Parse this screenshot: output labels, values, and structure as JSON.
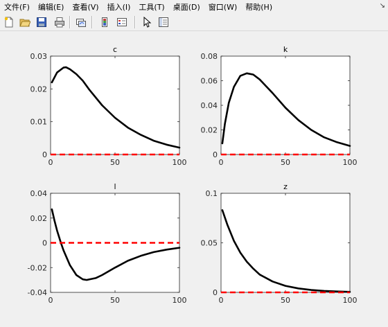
{
  "menu": {
    "items": [
      {
        "label": "文件(F)"
      },
      {
        "label": "编辑(E)"
      },
      {
        "label": "查看(V)"
      },
      {
        "label": "插入(I)"
      },
      {
        "label": "工具(T)"
      },
      {
        "label": "桌面(D)"
      },
      {
        "label": "窗口(W)"
      },
      {
        "label": "帮助(H)"
      }
    ],
    "dock_arrow": "↘"
  },
  "toolbar": {
    "buttons": [
      "new-figure-icon",
      "open-file-icon",
      "save-icon",
      "print-icon",
      "link-plot-icon",
      "insert-colorbar-icon",
      "insert-legend-icon",
      "edit-plot-arrow-icon",
      "property-inspector-icon"
    ]
  },
  "colors": {
    "series": "#000000",
    "zero_line": "#ff0000",
    "axes_bg": "#ffffff",
    "figure_bg": "#f0f0f0"
  },
  "chart_data": [
    {
      "type": "line",
      "title": "c",
      "xlim": [
        0,
        100
      ],
      "ylim": [
        0,
        0.03
      ],
      "xticks": [
        0,
        50,
        100
      ],
      "xtick_labels": [
        "0",
        "50",
        "100"
      ],
      "yticks": [
        0,
        0.01,
        0.02,
        0.03
      ],
      "ytick_labels": [
        "0",
        "0.01",
        "0.02",
        "0.03"
      ],
      "series": [
        {
          "x": [
            1,
            5,
            10,
            12,
            15,
            20,
            25,
            30,
            40,
            50,
            60,
            70,
            80,
            90,
            100
          ],
          "y": [
            0.022,
            0.025,
            0.0265,
            0.0266,
            0.026,
            0.0245,
            0.0225,
            0.0198,
            0.015,
            0.0112,
            0.0082,
            0.006,
            0.0042,
            0.003,
            0.0021
          ],
          "style": "solid"
        },
        {
          "x": [
            0,
            100
          ],
          "y": [
            0,
            0
          ],
          "style": "dashed"
        }
      ]
    },
    {
      "type": "line",
      "title": "k",
      "xlim": [
        0,
        100
      ],
      "ylim": [
        0,
        0.08
      ],
      "xticks": [
        0,
        50,
        100
      ],
      "xtick_labels": [
        "0",
        "50",
        "100"
      ],
      "yticks": [
        0,
        0.02,
        0.04,
        0.06,
        0.08
      ],
      "ytick_labels": [
        "0",
        "0.02",
        "0.04",
        "0.06",
        "0.08"
      ],
      "series": [
        {
          "x": [
            1,
            3,
            6,
            10,
            15,
            20,
            25,
            30,
            40,
            50,
            60,
            70,
            80,
            90,
            100
          ],
          "y": [
            0.009,
            0.025,
            0.042,
            0.055,
            0.064,
            0.066,
            0.065,
            0.061,
            0.05,
            0.038,
            0.028,
            0.02,
            0.014,
            0.01,
            0.007
          ],
          "style": "solid"
        },
        {
          "x": [
            0,
            100
          ],
          "y": [
            0,
            0
          ],
          "style": "dashed"
        }
      ]
    },
    {
      "type": "line",
      "title": "l",
      "xlim": [
        0,
        100
      ],
      "ylim": [
        -0.04,
        0.04
      ],
      "xticks": [
        0,
        50,
        100
      ],
      "xtick_labels": [
        "0",
        "50",
        "100"
      ],
      "yticks": [
        -0.04,
        -0.02,
        0,
        0.02,
        0.04
      ],
      "ytick_labels": [
        "-0.04",
        "-0.02",
        "0",
        "0.02",
        "0.04"
      ],
      "series": [
        {
          "x": [
            1,
            3,
            5,
            8,
            10,
            15,
            20,
            25,
            28,
            35,
            40,
            50,
            60,
            70,
            80,
            90,
            100
          ],
          "y": [
            0.027,
            0.018,
            0.01,
            0.0,
            -0.006,
            -0.018,
            -0.026,
            -0.0295,
            -0.03,
            -0.0285,
            -0.026,
            -0.02,
            -0.0145,
            -0.0105,
            -0.0075,
            -0.0055,
            -0.004
          ],
          "style": "solid"
        },
        {
          "x": [
            0,
            100
          ],
          "y": [
            0,
            0
          ],
          "style": "dashed"
        }
      ]
    },
    {
      "type": "line",
      "title": "z",
      "xlim": [
        0,
        100
      ],
      "ylim": [
        0,
        0.1
      ],
      "xticks": [
        0,
        50,
        100
      ],
      "xtick_labels": [
        "0",
        "50",
        "100"
      ],
      "yticks": [
        0,
        0.05,
        0.1
      ],
      "ytick_labels": [
        "0",
        "0.05",
        "0.1"
      ],
      "series": [
        {
          "x": [
            1,
            5,
            10,
            15,
            20,
            25,
            30,
            40,
            50,
            60,
            70,
            80,
            90,
            100
          ],
          "y": [
            0.083,
            0.068,
            0.052,
            0.04,
            0.031,
            0.024,
            0.018,
            0.011,
            0.0066,
            0.004,
            0.0024,
            0.0015,
            0.0009,
            0.0005
          ],
          "style": "solid"
        },
        {
          "x": [
            0,
            100
          ],
          "y": [
            0,
            0
          ],
          "style": "dashed"
        }
      ]
    }
  ]
}
